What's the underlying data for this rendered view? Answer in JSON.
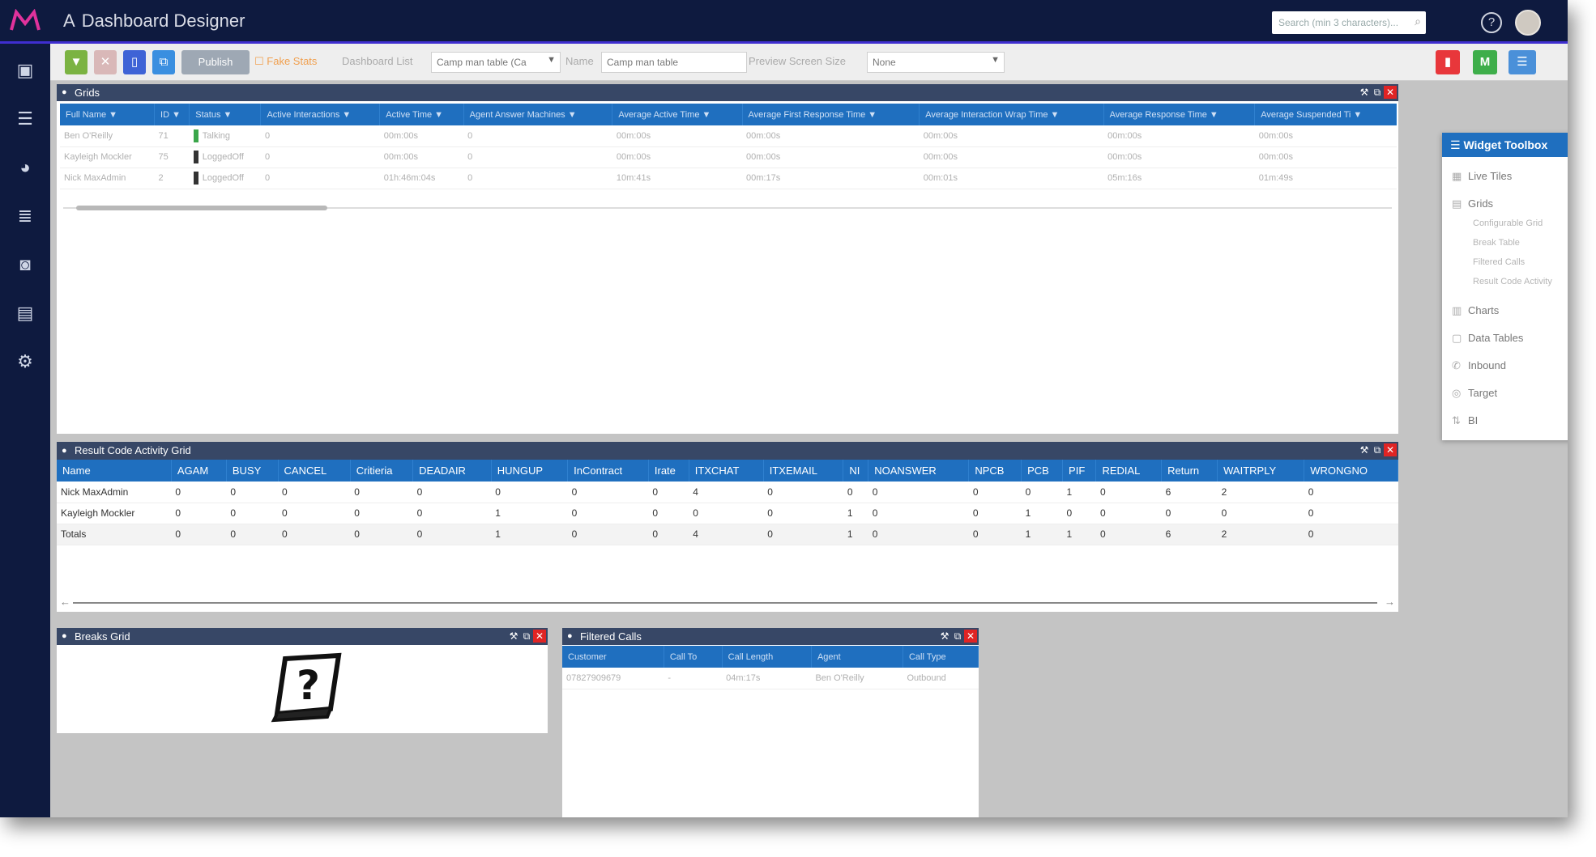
{
  "app": {
    "title": "Dashboard Designer",
    "search_placeholder": "Search (min 3 characters)..."
  },
  "colors": {
    "navy": "#0e1a3f",
    "accent_purple": "#3f2ed0",
    "header_blue": "#1f6fbf",
    "widget_head": "#374766",
    "close_red": "#e02424"
  },
  "sidebar": {
    "icons": [
      "home-icon",
      "list-icon",
      "gauge-icon",
      "database-icon",
      "user-headset-icon",
      "document-icon",
      "settings-icon"
    ]
  },
  "toolbar": {
    "publish_label": "Publish",
    "fake_stats_label": "Fake Stats",
    "dashboard_list_label": "Dashboard List",
    "dashboard_list_value": "Camp man table (Ca",
    "name_label": "Name",
    "name_value": "Camp man table",
    "preview_size_label": "Preview Screen Size",
    "preview_size_value": "None"
  },
  "grids_widget": {
    "title": "Grids",
    "columns": [
      "Full Name",
      "ID",
      "Status",
      "Active Interactions",
      "Active Time",
      "Agent Answer Machines",
      "Average Active Time",
      "Average First Response Time",
      "Average Interaction Wrap Time",
      "Average Response Time",
      "Average Suspended Ti"
    ],
    "rows": [
      {
        "status_color": "#3aa64a",
        "cells": [
          "Ben O'Reilly",
          "71",
          "Talking",
          "0",
          "00m:00s",
          "0",
          "00m:00s",
          "00m:00s",
          "00m:00s",
          "00m:00s",
          "00m:00s"
        ]
      },
      {
        "status_color": "#333333",
        "cells": [
          "Kayleigh Mockler",
          "75",
          "LoggedOff",
          "0",
          "00m:00s",
          "0",
          "00m:00s",
          "00m:00s",
          "00m:00s",
          "00m:00s",
          "00m:00s"
        ]
      },
      {
        "status_color": "#333333",
        "cells": [
          "Nick MaxAdmin",
          "2",
          "LoggedOff",
          "0",
          "01h:46m:04s",
          "0",
          "10m:41s",
          "00m:17s",
          "00m:01s",
          "05m:16s",
          "01m:49s"
        ]
      }
    ]
  },
  "result_code_grid": {
    "title": "Result Code Activity Grid",
    "columns": [
      "Name",
      "AGAM",
      "BUSY",
      "CANCEL",
      "Critieria",
      "DEADAIR",
      "HUNGUP",
      "InContract",
      "Irate",
      "ITXCHAT",
      "ITXEMAIL",
      "NI",
      "NOANSWER",
      "NPCB",
      "PCB",
      "PIF",
      "REDIAL",
      "Return",
      "WAITRPLY",
      "WRONGNO"
    ],
    "rows": [
      [
        "Nick MaxAdmin",
        "0",
        "0",
        "0",
        "0",
        "0",
        "0",
        "0",
        "0",
        "4",
        "0",
        "0",
        "0",
        "0",
        "0",
        "1",
        "0",
        "6",
        "2",
        "0"
      ],
      [
        "Kayleigh Mockler",
        "0",
        "0",
        "0",
        "0",
        "0",
        "1",
        "0",
        "0",
        "0",
        "0",
        "1",
        "0",
        "0",
        "1",
        "0",
        "0",
        "0",
        "0",
        "0"
      ],
      [
        "Totals",
        "0",
        "0",
        "0",
        "0",
        "0",
        "1",
        "0",
        "0",
        "4",
        "0",
        "1",
        "0",
        "0",
        "1",
        "1",
        "0",
        "6",
        "2",
        "0"
      ]
    ]
  },
  "breaks_grid": {
    "title": "Breaks Grid"
  },
  "filtered_calls": {
    "title": "Filtered Calls",
    "columns": [
      "Customer",
      "Call To",
      "Call Length",
      "Agent",
      "Call Type"
    ],
    "rows": [
      [
        "07827909679",
        "-",
        "04m:17s",
        "Ben O'Reilly",
        "Outbound"
      ]
    ]
  },
  "toolbox": {
    "title": "Widget Toolbox",
    "items": [
      {
        "label": "Live Tiles",
        "icon": "tiles-icon"
      },
      {
        "label": "Grids",
        "icon": "grid-icon"
      },
      {
        "label": "Charts",
        "icon": "chart-icon"
      },
      {
        "label": "Data Tables",
        "icon": "table-icon"
      },
      {
        "label": "Inbound",
        "icon": "phone-icon"
      },
      {
        "label": "Target",
        "icon": "target-icon"
      },
      {
        "label": "BI",
        "icon": "bi-icon"
      }
    ],
    "grid_subitems": [
      "Configurable Grid",
      "Break Table",
      "Filtered Calls",
      "Result Code Activity"
    ]
  }
}
